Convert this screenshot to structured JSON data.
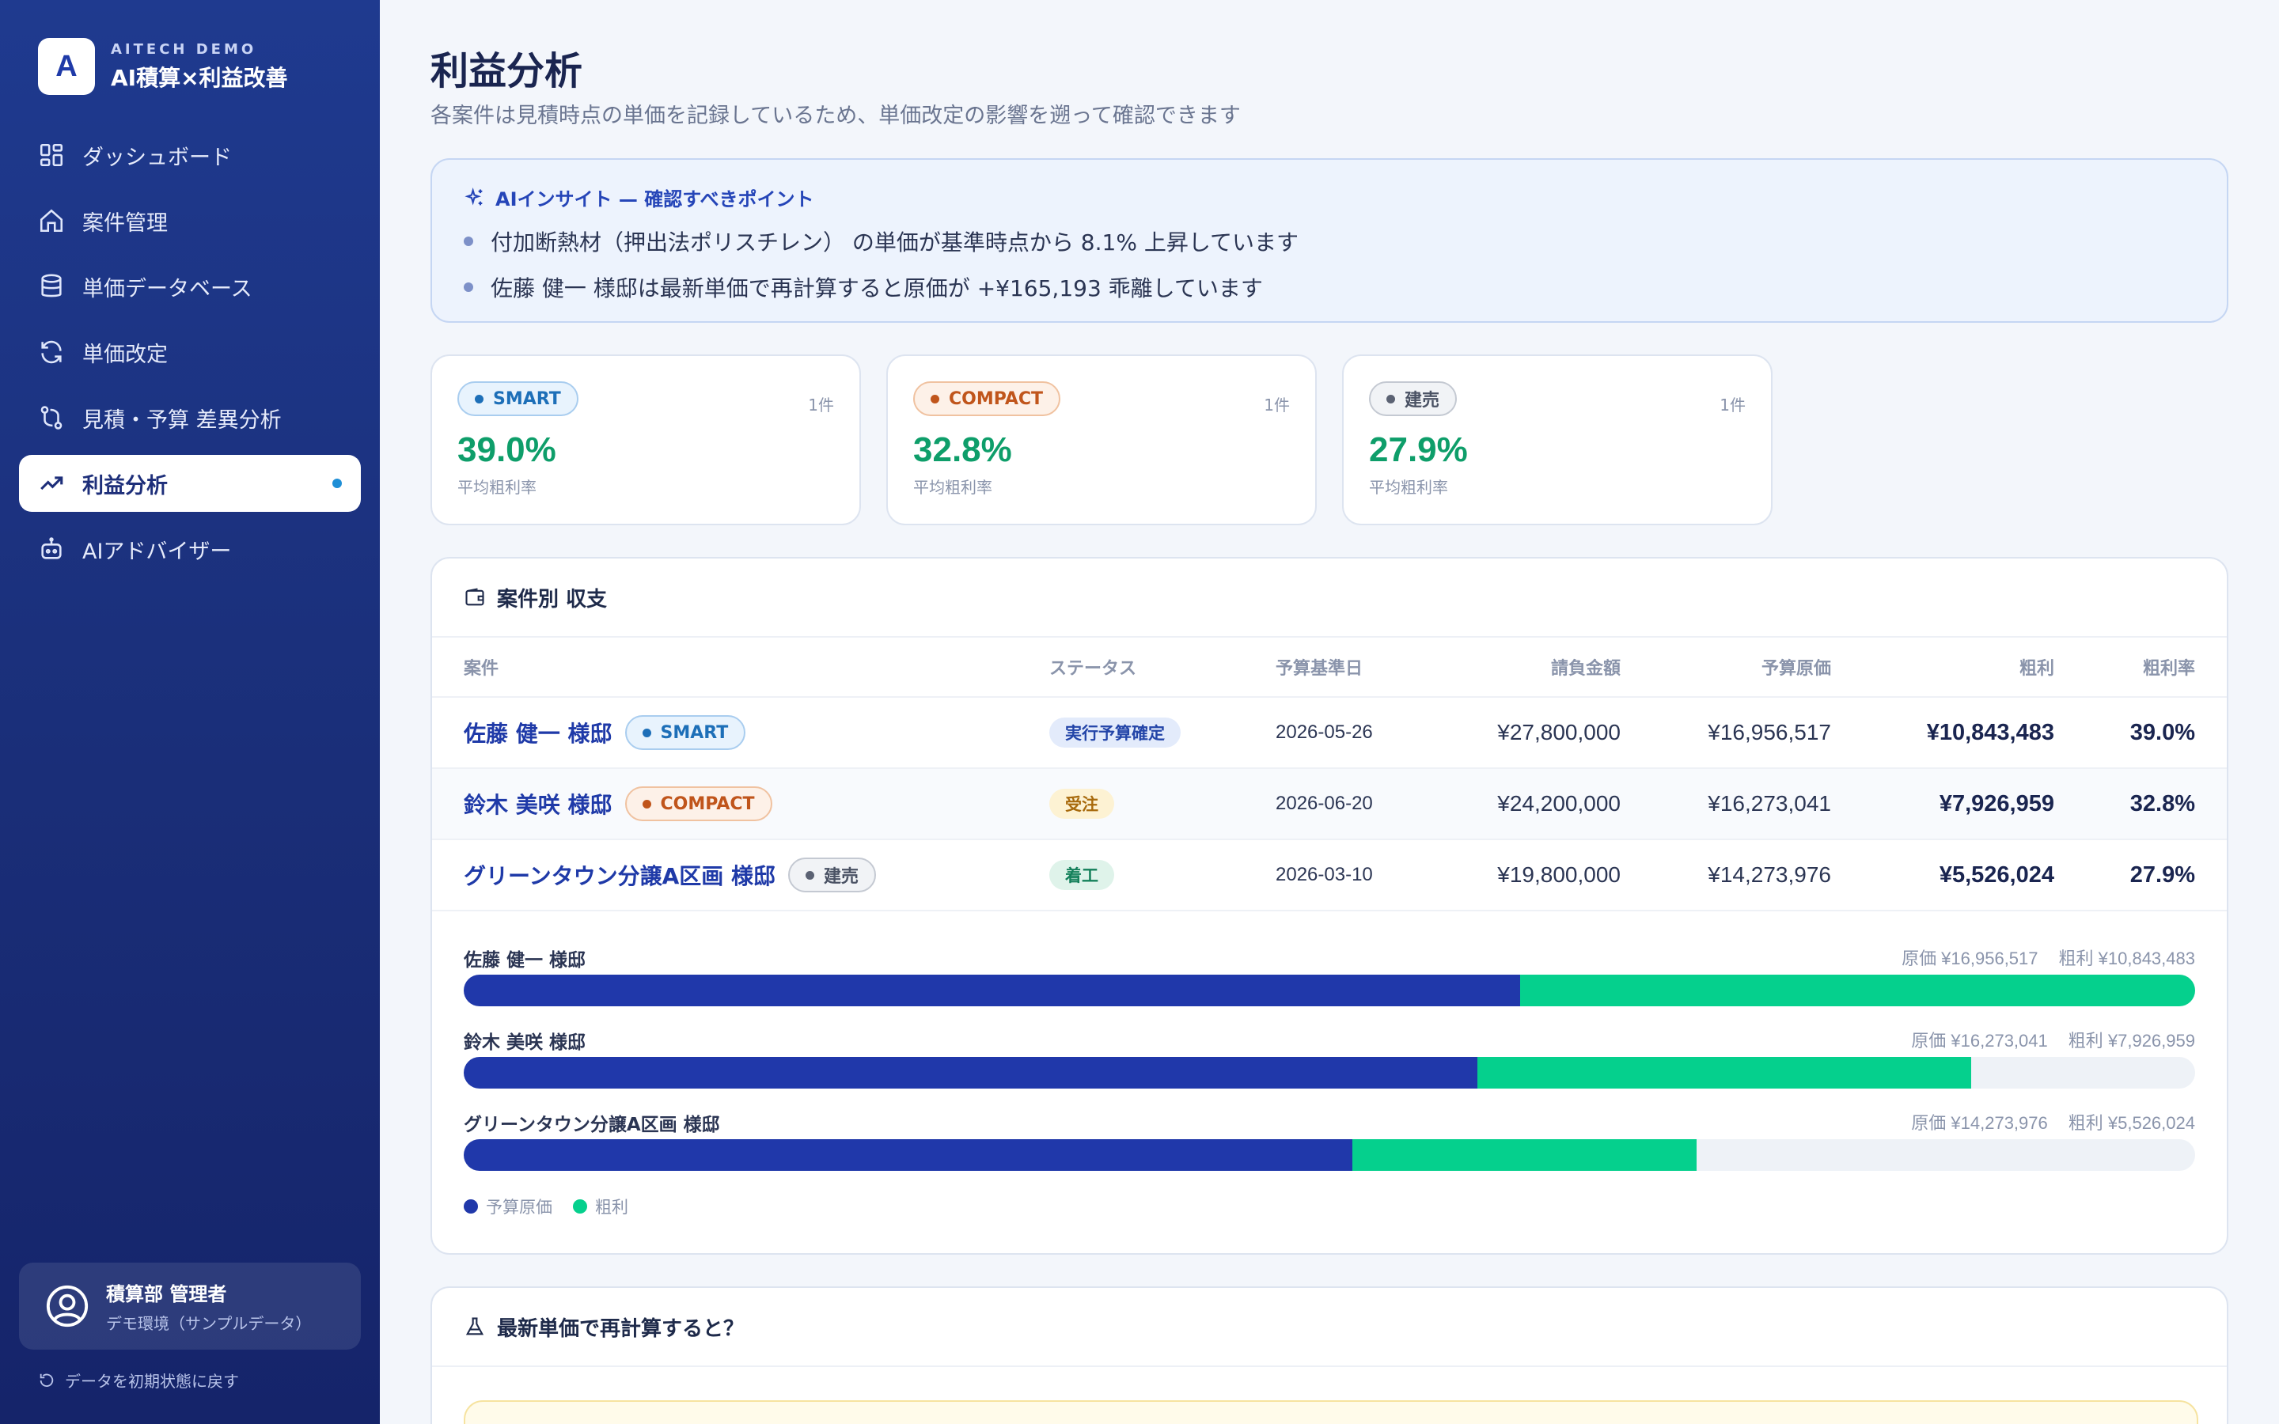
{
  "brand": {
    "logo": "A",
    "sub": "AITECH DEMO",
    "title": "AI積算×利益改善"
  },
  "nav": [
    {
      "label": "ダッシュボード",
      "icon": "dashboard-icon"
    },
    {
      "label": "案件管理",
      "icon": "home-icon"
    },
    {
      "label": "単価データベース",
      "icon": "database-icon"
    },
    {
      "label": "単価改定",
      "icon": "refresh-icon"
    },
    {
      "label": "見積・予算 差異分析",
      "icon": "compare-icon"
    },
    {
      "label": "利益分析",
      "icon": "trending-up-icon",
      "active": true
    },
    {
      "label": "AIアドバイザー",
      "icon": "robot-icon"
    }
  ],
  "user": {
    "name": "積算部 管理者",
    "env": "デモ環境（サンプルデータ）"
  },
  "reset_label": "データを初期状態に戻す",
  "page": {
    "title": "利益分析",
    "subtitle": "各案件は見積時点の単価を記録しているため、単価改定の影響を遡って確認できます"
  },
  "insight": {
    "title": "AIインサイト — 確認すべきポイント",
    "items": [
      "付加断熱材（押出法ポリスチレン） の単価が基準時点から 8.1% 上昇しています",
      "佐藤 健一 様邸は最新単価で再計算すると原価が +¥165,193 乖離しています"
    ]
  },
  "kpis": [
    {
      "tag": "SMART",
      "count": "1件",
      "value": "39.0%",
      "label": "平均粗利率"
    },
    {
      "tag": "COMPACT",
      "count": "1件",
      "value": "32.8%",
      "label": "平均粗利率"
    },
    {
      "tag": "建売",
      "count": "1件",
      "value": "27.9%",
      "label": "平均粗利率"
    }
  ],
  "table": {
    "title": "案件別 収支",
    "headers": {
      "name": "案件",
      "status": "ステータス",
      "date": "予算基準日",
      "bid": "請負金額",
      "cost": "予算原価",
      "gross": "粗利",
      "rate": "粗利率"
    },
    "rows": [
      {
        "name": "佐藤 健一 様邸",
        "tag": "SMART",
        "status": "実行予算確定",
        "date": "2026-05-26",
        "bid": "¥27,800,000",
        "cost": "¥16,956,517",
        "gross": "¥10,843,483",
        "rate": "39.0%"
      },
      {
        "name": "鈴木 美咲 様邸",
        "tag": "COMPACT",
        "status": "受注",
        "date": "2026-06-20",
        "bid": "¥24,200,000",
        "cost": "¥16,273,041",
        "gross": "¥7,926,959",
        "rate": "32.8%"
      },
      {
        "name": "グリーンタウン分譲A区画 様邸",
        "tag": "建売",
        "status": "着工",
        "date": "2026-03-10",
        "bid": "¥19,800,000",
        "cost": "¥14,273,976",
        "gross": "¥5,526,024",
        "rate": "27.9%"
      }
    ]
  },
  "chart_data": {
    "type": "bar",
    "orientation": "horizontal-stacked",
    "categories": [
      "佐藤 健一 様邸",
      "鈴木 美咲 様邸",
      "グリーンタウン分譲A区画 様邸"
    ],
    "series": [
      {
        "name": "予算原価",
        "values": [
          16956517,
          16273041,
          14273976
        ],
        "color": "#2038aa"
      },
      {
        "name": "粗利",
        "values": [
          10843483,
          7926959,
          5526024
        ],
        "color": "#05d08d"
      }
    ],
    "xlim": [
      0,
      27800000
    ],
    "notes": [
      {
        "cost": "原価 ¥16,956,517",
        "gross": "粗利 ¥10,843,483"
      },
      {
        "cost": "原価 ¥16,273,041",
        "gross": "粗利 ¥7,926,959"
      },
      {
        "cost": "原価 ¥14,273,976",
        "gross": "粗利 ¥5,526,024"
      }
    ]
  },
  "recalc": {
    "title": "最新単価で再計算すると？"
  }
}
